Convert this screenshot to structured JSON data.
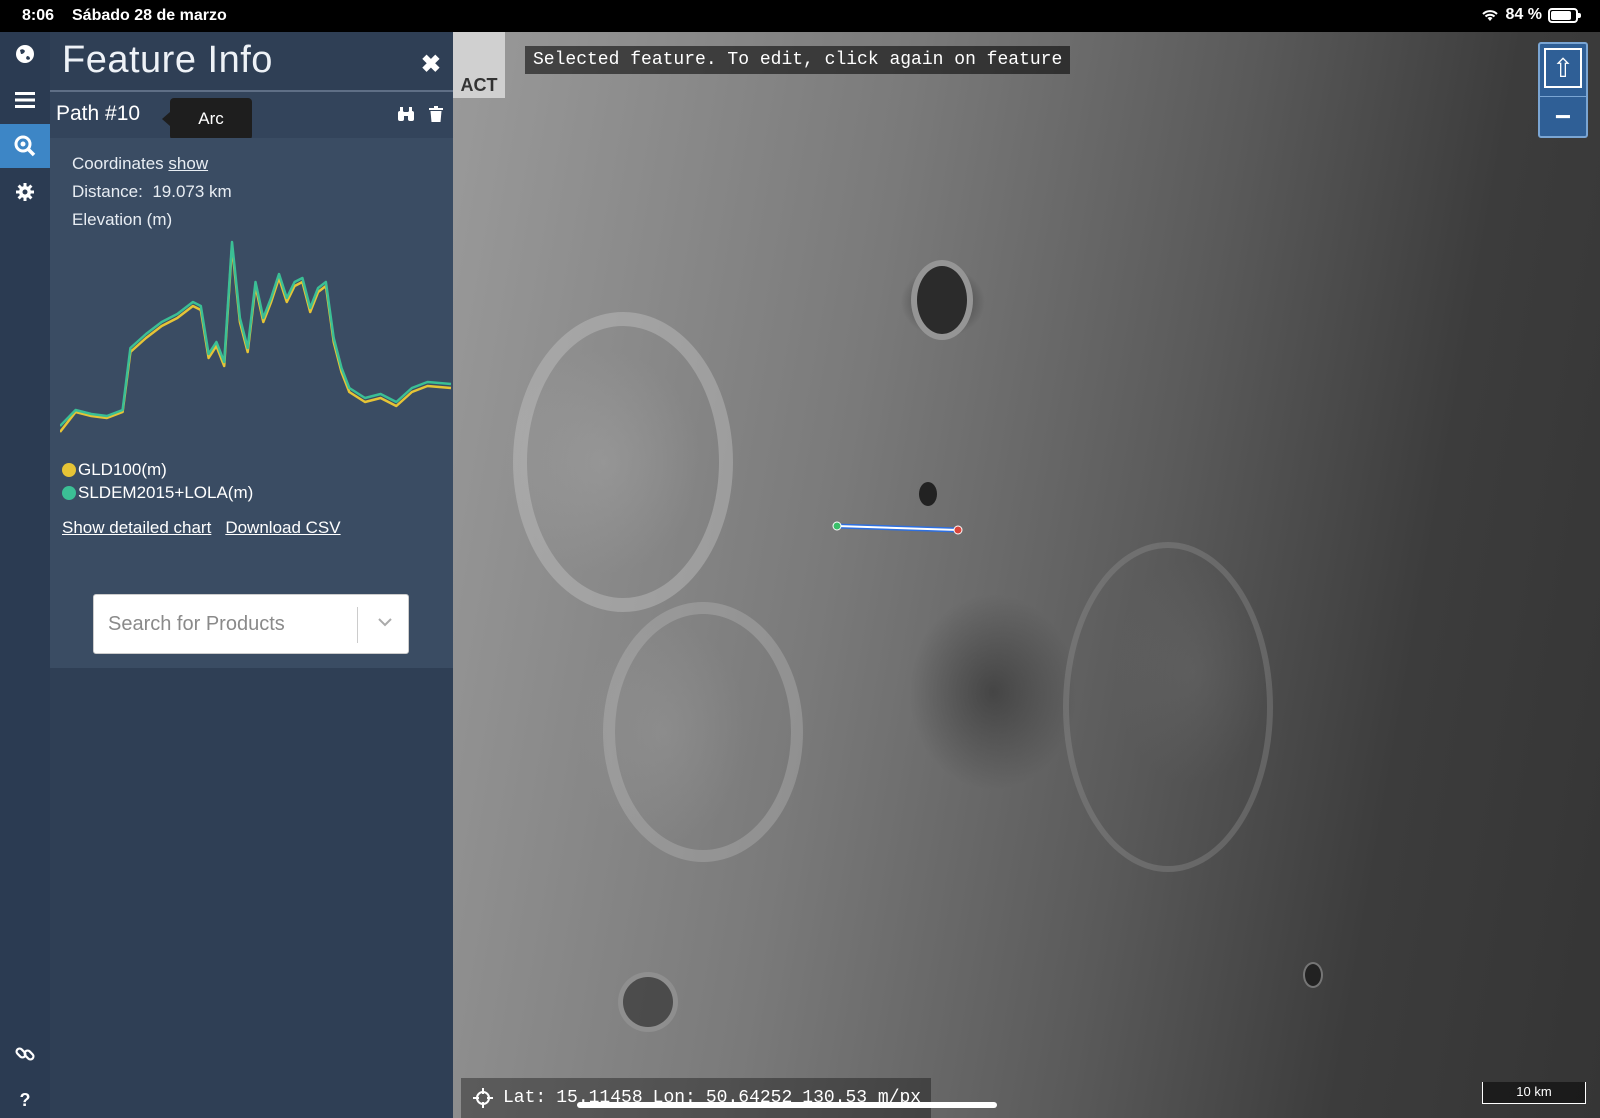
{
  "status_bar": {
    "time": "8:06",
    "date": "Sábado 28 de marzo",
    "battery": "84 %",
    "battery_level": 0.84
  },
  "rail": {
    "icons": [
      "globe-icon",
      "menu-icon",
      "search-zoom-icon",
      "gear-icon",
      "link-icon",
      "help-icon"
    ],
    "help_label": "?"
  },
  "panel": {
    "title": "Feature Info",
    "close_label": "✖",
    "path_name": "Path #10",
    "tooltip": "Arc",
    "coordinates_label": "Coordinates",
    "coordinates_link": "show",
    "distance_label": "Distance:",
    "distance_value": "19.073 km",
    "elevation_label": "Elevation (m)",
    "legend": [
      {
        "name": "GLD100(m)",
        "color": "#e6c436"
      },
      {
        "name": "SLDEM2015+LOLA(m)",
        "color": "#3bbf95"
      }
    ],
    "show_chart_link": "Show detailed chart",
    "download_link": "Download CSV",
    "search_placeholder": "Search for Products"
  },
  "chart_data": {
    "type": "line",
    "title": "Elevation (m)",
    "x": [
      0,
      0.04,
      0.08,
      0.12,
      0.16,
      0.18,
      0.22,
      0.26,
      0.3,
      0.34,
      0.36,
      0.38,
      0.4,
      0.42,
      0.44,
      0.46,
      0.48,
      0.5,
      0.52,
      0.54,
      0.56,
      0.58,
      0.6,
      0.62,
      0.64,
      0.66,
      0.68,
      0.7,
      0.72,
      0.74,
      0.78,
      0.82,
      0.86,
      0.9,
      0.94,
      1.0
    ],
    "series": [
      {
        "name": "GLD100(m)",
        "values": [
          0.05,
          0.15,
          0.13,
          0.12,
          0.15,
          0.45,
          0.52,
          0.58,
          0.62,
          0.68,
          0.66,
          0.42,
          0.48,
          0.38,
          0.98,
          0.6,
          0.45,
          0.78,
          0.6,
          0.7,
          0.82,
          0.7,
          0.78,
          0.8,
          0.65,
          0.75,
          0.78,
          0.5,
          0.35,
          0.25,
          0.2,
          0.22,
          0.18,
          0.25,
          0.28,
          0.27
        ]
      },
      {
        "name": "SLDEM2015+LOLA(m)",
        "values": [
          0.08,
          0.16,
          0.14,
          0.13,
          0.16,
          0.47,
          0.54,
          0.6,
          0.64,
          0.7,
          0.68,
          0.44,
          0.5,
          0.4,
          1.0,
          0.62,
          0.47,
          0.8,
          0.62,
          0.72,
          0.84,
          0.72,
          0.8,
          0.82,
          0.67,
          0.77,
          0.8,
          0.52,
          0.37,
          0.27,
          0.22,
          0.24,
          0.2,
          0.27,
          0.3,
          0.29
        ]
      }
    ],
    "grid": false
  },
  "map": {
    "logo": "ACT",
    "banner": "Selected feature. To edit, click again on feature",
    "lat_label": "Lat:",
    "lat_value": "15.11458",
    "lon_label": "Lon:",
    "lon_value": "50.64252",
    "resolution": "130.53 m/px",
    "scale": "10 km",
    "home_label": "⇧",
    "zoom_out_label": "−"
  }
}
